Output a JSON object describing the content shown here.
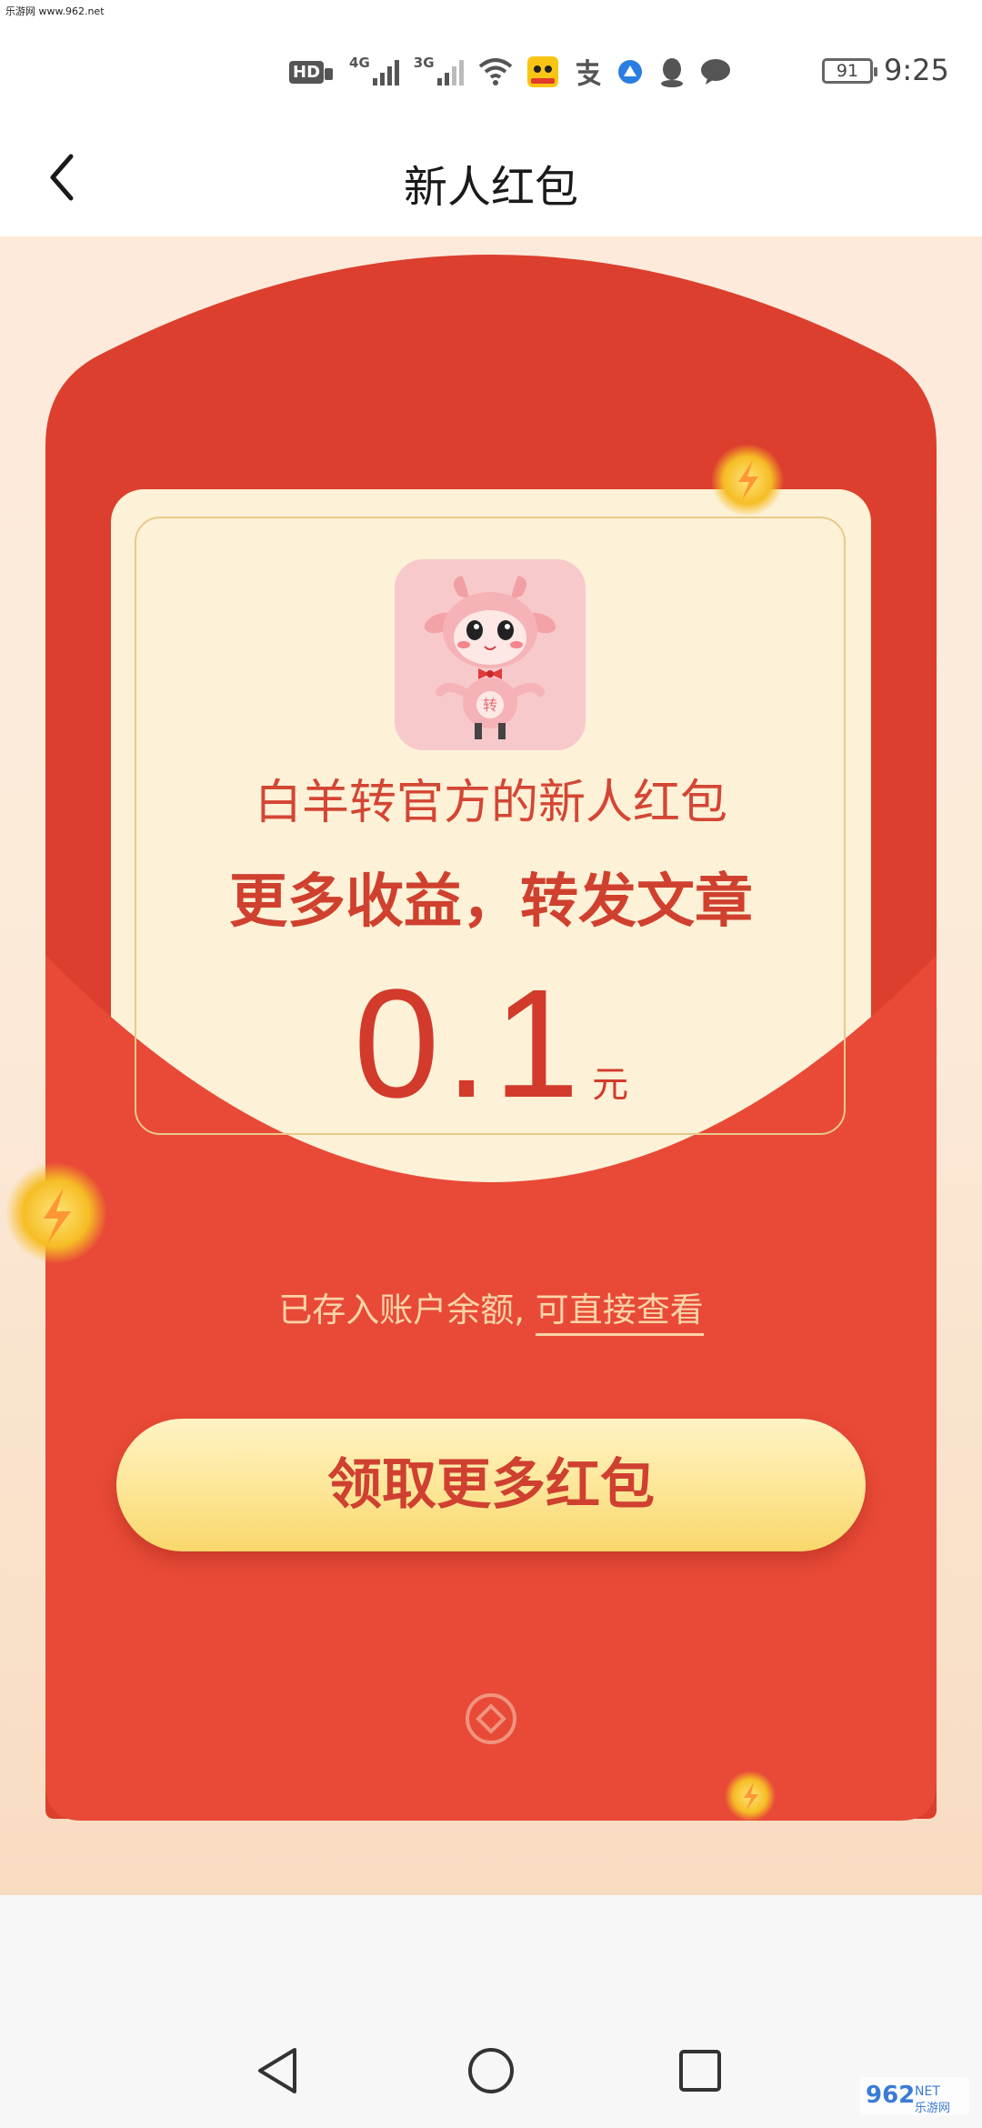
{
  "status_bar": {
    "site_watermark": "乐游网 www.962.net",
    "network_1": "4G",
    "network_2": "3G",
    "hd_label": "HD",
    "battery": "91",
    "time": "9:25"
  },
  "nav": {
    "title": "新人红包",
    "back_icon": "chevron-left-icon"
  },
  "packet": {
    "sender": "白羊转官方的新人红包",
    "headline": "更多收益，转发文章",
    "amount": "0.1",
    "unit": "元",
    "deposit_text": "已存入账户余额, ",
    "deposit_link": "可直接查看",
    "button_label": "领取更多红包",
    "avatar_char": "转"
  },
  "colors": {
    "envelope_red": "#e84a37",
    "envelope_top": "#dc3f2e",
    "card_cream": "#fdf1d7",
    "button_gold": "#fde79a",
    "text_red": "#d23a2c"
  },
  "system_nav": {
    "back": "triangle-back-icon",
    "home": "circle-home-icon",
    "recents": "square-recents-icon"
  },
  "watermark": {
    "number": "962",
    "suffix": "NET",
    "text": "乐游网"
  }
}
